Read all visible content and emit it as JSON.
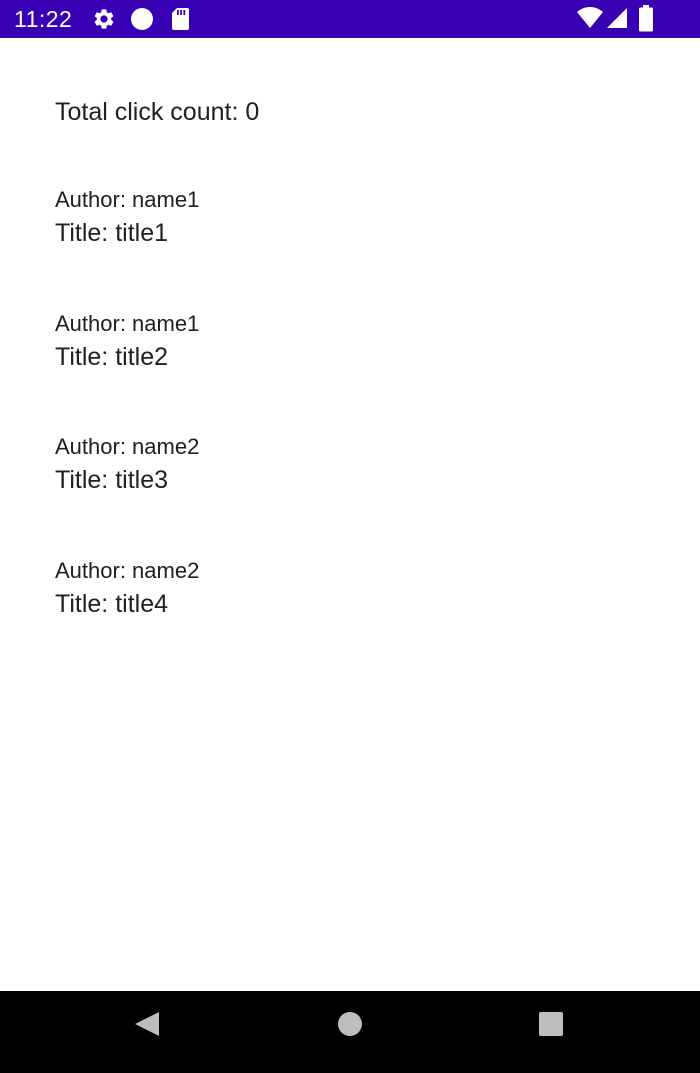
{
  "status_bar": {
    "time": "11:22",
    "background_color": "#3700b3",
    "icons": [
      "gear-icon",
      "circle-dot-icon",
      "sd-card-icon",
      "wifi-icon",
      "signal-icon",
      "battery-icon"
    ]
  },
  "main": {
    "click_count_text": "Total click count: 0",
    "books": [
      {
        "author": "Author: name1",
        "title": "Title: title1"
      },
      {
        "author": "Author: name1",
        "title": "Title: title2"
      },
      {
        "author": "Author: name2",
        "title": "Title: title3"
      },
      {
        "author": "Author: name2",
        "title": "Title: title4"
      }
    ]
  },
  "nav_bar": {
    "buttons": [
      "back-icon",
      "home-icon",
      "recents-icon"
    ]
  }
}
